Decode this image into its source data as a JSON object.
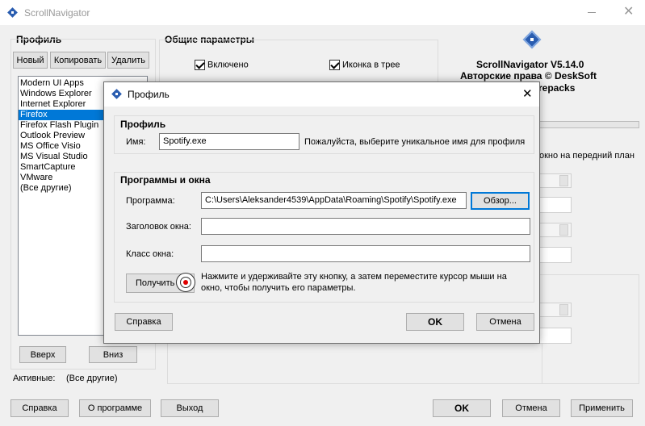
{
  "main_window": {
    "title": "ScrollNavigator",
    "profile_section": {
      "title": "Профиль",
      "new_label": "Новый",
      "copy_label": "Копировать",
      "delete_label": "Удалить",
      "list_items": [
        "Modern UI Apps",
        "Windows Explorer",
        "Internet Explorer",
        "Firefox",
        "Firefox Flash Plugin",
        "Outlook Preview",
        "MS Office Visio",
        "MS Visual Studio",
        "SmartCapture",
        "VMware",
        "(Все другие)"
      ],
      "selected_item": "Firefox",
      "up_label": "Вверх",
      "down_label": "Вниз",
      "active_label": "Активные:",
      "active_value": "(Все другие)"
    },
    "general": {
      "title": "Общие параметры",
      "enabled_label": "Включено",
      "tray_icon_label": "Иконка в трее"
    },
    "about": {
      "version": "ScrollNavigator V5.14.0",
      "copyright_partial": "Авторские права © DeskSoft",
      "partial_text": "repacks",
      "foreground_partial": "окно на передний план"
    },
    "footer": {
      "help_label": "Справка",
      "about_label": "О программе",
      "exit_label": "Выход",
      "ok_label": "OK",
      "cancel_label": "Отмена",
      "apply_label": "Применить"
    }
  },
  "dialog": {
    "title": "Профиль",
    "close_symbol": "✕",
    "profile_group": {
      "title": "Профиль",
      "name_label": "Имя:",
      "name_value": "Spotify.exe",
      "name_hint": "Пожалуйста, выберите уникальное имя для профиля"
    },
    "programs_group": {
      "title": "Программы и окна",
      "program_label": "Программа:",
      "program_value": "C:\\Users\\Aleksander4539\\AppData\\Roaming\\Spotify\\Spotify.exe",
      "browse_label": "Обзор...",
      "window_title_label": "Заголовок окна:",
      "window_title_value": "",
      "window_class_label": "Класс окна:",
      "window_class_value": "",
      "get_label": "Получить",
      "get_hint": "Нажмите и удерживайте эту кнопку, а затем переместите курсор мыши на окно, чтобы получить его параметры."
    },
    "help_label": "Справка",
    "ok_label": "OK",
    "cancel_label": "Отмена"
  },
  "colors": {
    "selection": "#0078d7",
    "focus_border": "#0078d7",
    "icon_blue": "#2a5db0",
    "window_bg": "#f0f0f0"
  },
  "icons": [
    "app-icon",
    "minimize-icon",
    "close-icon",
    "scrollnavigator-logo-icon",
    "crosshair-target-icon"
  ]
}
